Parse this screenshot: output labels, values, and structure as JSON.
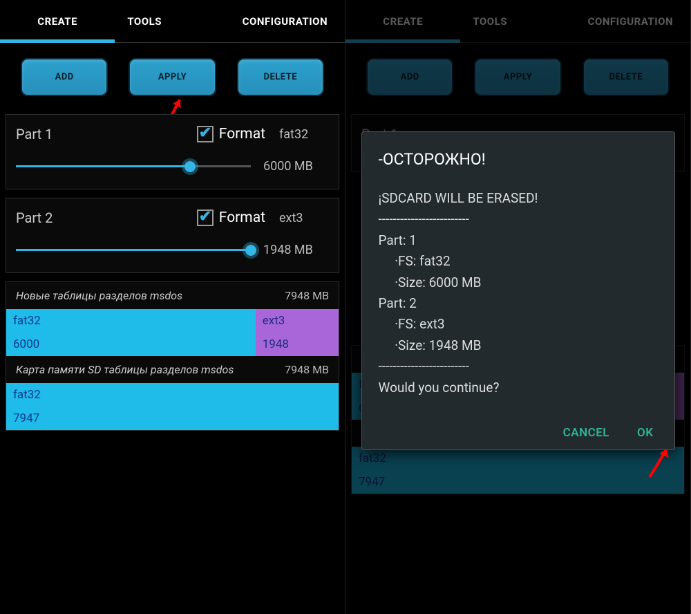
{
  "tabs": {
    "create": "CREATE",
    "tools": "TOOLS",
    "config": "CONFIGURATION"
  },
  "actions": {
    "add": "ADD",
    "apply": "APPLY",
    "delete": "DELETE"
  },
  "part1": {
    "title": "Part 1",
    "format_label": "Format",
    "fs": "fat32",
    "size": "6000 MB",
    "slider_pct": 74
  },
  "part2": {
    "title": "Part 2",
    "format_label": "Format",
    "fs": "ext3",
    "size": "1948 MB",
    "slider_pct": 100
  },
  "tables": {
    "new": {
      "title": "Новые таблицы разделов msdos",
      "total": "7948 MB",
      "parts": [
        {
          "fs": "fat32",
          "size": "6000",
          "pct": 75,
          "color": "cyan"
        },
        {
          "fs": "ext3",
          "size": "1948",
          "pct": 25,
          "color": "purple"
        }
      ]
    },
    "sd": {
      "title": "Карта памяти SD таблицы разделов msdos",
      "total": "7948 MB",
      "parts": [
        {
          "fs": "fat32",
          "size": "7947",
          "pct": 100,
          "color": "cyan"
        }
      ]
    }
  },
  "dialog": {
    "title": "-ОСТОРОЖНО!",
    "body": "¡SDCARD WILL BE ERASED!\n-------------------------\nPart: 1\n     ·FS: fat32\n     ·Size: 6000 MB\nPart: 2\n     ·FS: ext3\n     ·Size: 1948 MB\n-------------------------\nWould you continue?",
    "cancel": "CANCEL",
    "ok": "OK"
  }
}
